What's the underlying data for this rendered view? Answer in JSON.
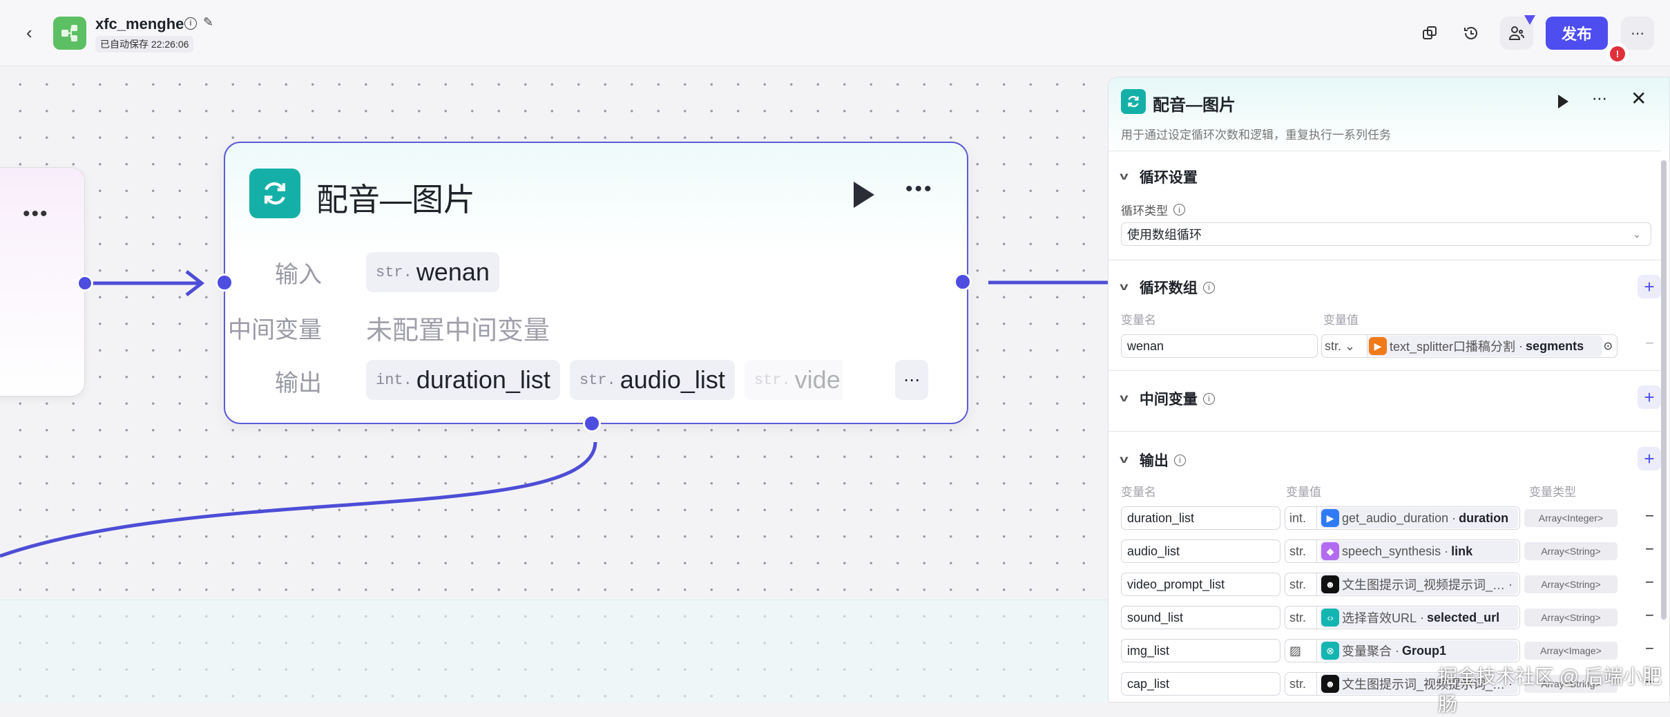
{
  "header": {
    "app_name": "xfc_menghe",
    "autosave": "已自动保存 22:26:06",
    "publish_label": "发布",
    "brand_color": "#4d4df0"
  },
  "canvas": {
    "node": {
      "title": "配音—图片",
      "input_label": "输入",
      "inputs": [
        {
          "type": "str.",
          "name": "wenan"
        }
      ],
      "intermediate_label": "中间变量",
      "intermediate_empty": "未配置中间变量",
      "output_label": "输出",
      "outputs": [
        {
          "type": "int.",
          "name": "duration_list"
        },
        {
          "type": "str.",
          "name": "audio_list"
        },
        {
          "type": "str.",
          "name": "vide"
        }
      ]
    }
  },
  "panel": {
    "title": "配音—图片",
    "description": "用于通过设定循环次数和逻辑，重复执行一系列任务",
    "loop_settings": {
      "title": "循环设置",
      "type_label": "循环类型",
      "type_value": "使用数组循环"
    },
    "loop_array": {
      "title": "循环数组",
      "col_name": "变量名",
      "col_value": "变量值",
      "rows": [
        {
          "name": "wenan",
          "type": "str.",
          "source": "text_splitter口播稿分割",
          "field": "segments",
          "color": "#f07a1a"
        }
      ]
    },
    "intermediate": {
      "title": "中间变量"
    },
    "outputs": {
      "title": "输出",
      "col_name": "变量名",
      "col_value": "变量值",
      "col_type": "变量类型",
      "rows": [
        {
          "name": "duration_list",
          "type": "int.",
          "source": "get_audio_duration",
          "field": "duration",
          "vtype": "Array<Integer>",
          "color": "#2f7bf5",
          "icon": "▶"
        },
        {
          "name": "audio_list",
          "type": "str.",
          "source": "speech_synthesis",
          "field": "link",
          "vtype": "Array<String>",
          "color": "#b36cf0",
          "icon": "◆"
        },
        {
          "name": "video_prompt_list",
          "type": "str.",
          "source": "文生图提示词_视频提示词_…",
          "field": "",
          "vtype": "Array<String>",
          "color": "#111111",
          "icon": "☻"
        },
        {
          "name": "sound_list",
          "type": "str.",
          "source": "选择音效URL",
          "field": "selected_url",
          "vtype": "Array<String>",
          "color": "#13b5b1",
          "icon": "‹›"
        },
        {
          "name": "img_list",
          "type": "img",
          "source": "变量聚合",
          "field": "Group1",
          "vtype": "Array<Image>",
          "color": "#13b5b1",
          "icon": "⊗"
        },
        {
          "name": "cap_list",
          "type": "str.",
          "source": "文生图提示词_视频提示词_…",
          "field": "",
          "vtype": "Array<String>",
          "color": "#111111",
          "icon": "☻"
        }
      ]
    }
  },
  "watermark": "掘金技术社区 @ 后端小肥肠"
}
